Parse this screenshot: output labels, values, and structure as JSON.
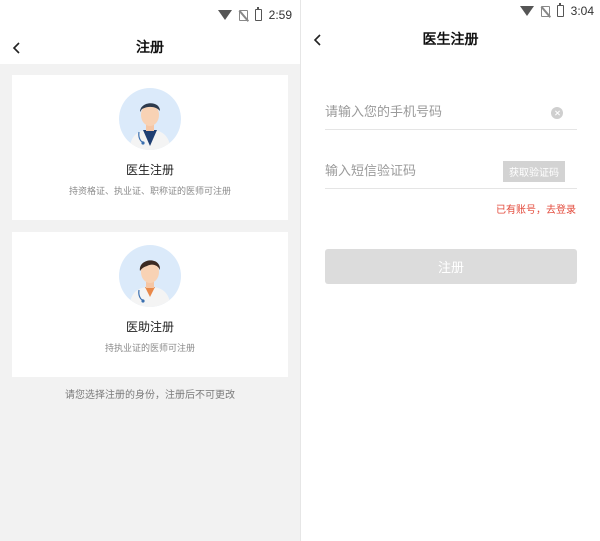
{
  "left": {
    "status": {
      "time": "2:59"
    },
    "nav": {
      "title": "注册"
    },
    "roles": [
      {
        "title": "医生注册",
        "subtitle": "持资格证、执业证、职称证的医师可注册"
      },
      {
        "title": "医助注册",
        "subtitle": "持执业证的医师可注册"
      }
    ],
    "hint": "请您选择注册的身份，注册后不可更改"
  },
  "right": {
    "status": {
      "time": "3:04"
    },
    "nav": {
      "title": "医生注册"
    },
    "phone": {
      "placeholder": "请输入您的手机号码",
      "value": ""
    },
    "code": {
      "placeholder": "输入短信验证码",
      "value": "",
      "button": "获取验证码"
    },
    "login_link": "已有账号，去登录",
    "submit": "注册"
  },
  "colors": {
    "link": "#e34a3b",
    "disabled": "#dcdcdc",
    "page_bg": "#f2f2f2",
    "avatar_bg": "#dbeafa"
  }
}
